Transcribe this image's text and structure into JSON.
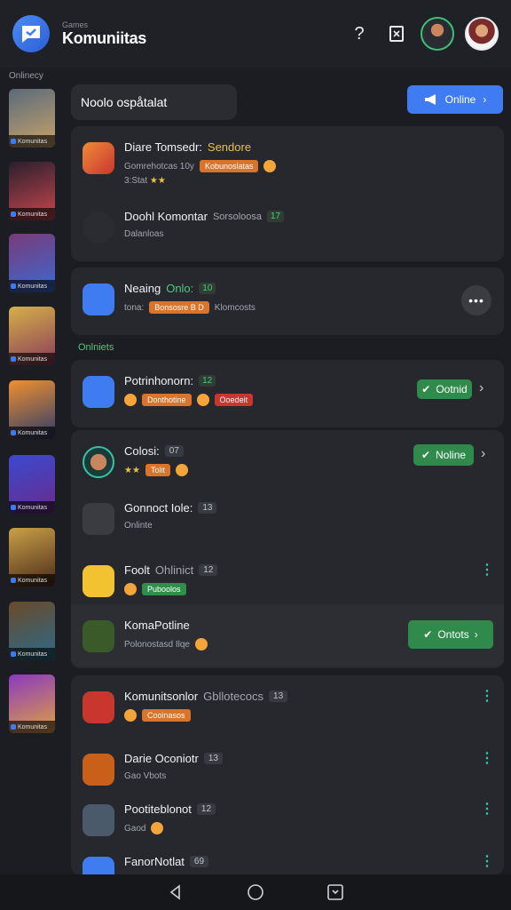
{
  "header": {
    "brand_sub": "Games",
    "brand_title": "Komuniitas",
    "help_icon": "?"
  },
  "sidebar": {
    "label": "Onlinecy",
    "thumbs": [
      {
        "caption": "Komunitas",
        "colors": [
          "#5a6a7a",
          "#c9a36b"
        ]
      },
      {
        "caption": "Komunitas",
        "colors": [
          "#2b1f2c",
          "#c9474f"
        ]
      },
      {
        "caption": "Komunitas",
        "colors": [
          "#7a3a7a",
          "#3a6ad0"
        ]
      },
      {
        "caption": "Komunitas",
        "colors": [
          "#d4b048",
          "#8a3a5a"
        ]
      },
      {
        "caption": "Komunitas",
        "colors": [
          "#f09030",
          "#2a3a6a"
        ]
      },
      {
        "caption": "Komunitas",
        "colors": [
          "#3a4ad0",
          "#6a2a8a"
        ]
      },
      {
        "caption": "Komunitas",
        "colors": [
          "#c9a048",
          "#4a2a1a"
        ]
      },
      {
        "caption": "Komunitas",
        "colors": [
          "#6a4a2a",
          "#2a6a8a"
        ]
      },
      {
        "caption": "Komunitas",
        "colors": [
          "#8a3ac0",
          "#e0a040"
        ]
      }
    ]
  },
  "search": {
    "placeholder": "Noolo ospåtalat"
  },
  "online_button": {
    "label": "Online"
  },
  "section_label": "Onlniets",
  "rows": [
    {
      "title": "Diare Tomsedr:",
      "badge": "Sendore",
      "sub": "Gomrehotcas 10y",
      "pill": "Kobunoslatas",
      "sub2": "3:Stat"
    },
    {
      "title": "Doohl Komontar",
      "badge": "Sorsoloosa",
      "badge2": "17",
      "sub": "Dalanloas"
    },
    {
      "title": "Neaing",
      "badge": "Onlo:",
      "badge2": "10",
      "sub": "tona:",
      "pill": "Bonsosre B D",
      "sub_tail": "Klomcosts"
    },
    {
      "title": "Potrinhonorn:",
      "badge": "12",
      "pill": "Donthotine",
      "pill2": "Ooedeit",
      "status": "Ootnid"
    },
    {
      "title": "Colosi:",
      "badge": "07",
      "pill": "Tolit",
      "status": "Noline"
    },
    {
      "title": "Gonnoct Iole:",
      "badge": "13",
      "sub": "Onlinte"
    },
    {
      "title": "Foolt",
      "badge": "Ohlinict",
      "badge2": "12",
      "pill": "Puboolos"
    },
    {
      "title": "KomaPotline",
      "sub": "Polonostasd Ilqe",
      "status": "Ontots"
    },
    {
      "title": "Komunitsonlor",
      "badge": "Gbllotecocs",
      "badge2": "13",
      "pill": "Cooinasos"
    },
    {
      "title": "Darie Oconiotr",
      "badge": "13",
      "sub": "Gao Vbots"
    },
    {
      "title": "Pootiteblonot",
      "badge": "12",
      "sub": "Gaod"
    },
    {
      "title": "FanorNotlat",
      "badge": "69"
    }
  ],
  "colors": {
    "accent_blue": "#3f7cf1",
    "accent_green": "#2f8a4b",
    "background": "#1b1d22",
    "card": "#26282d"
  }
}
